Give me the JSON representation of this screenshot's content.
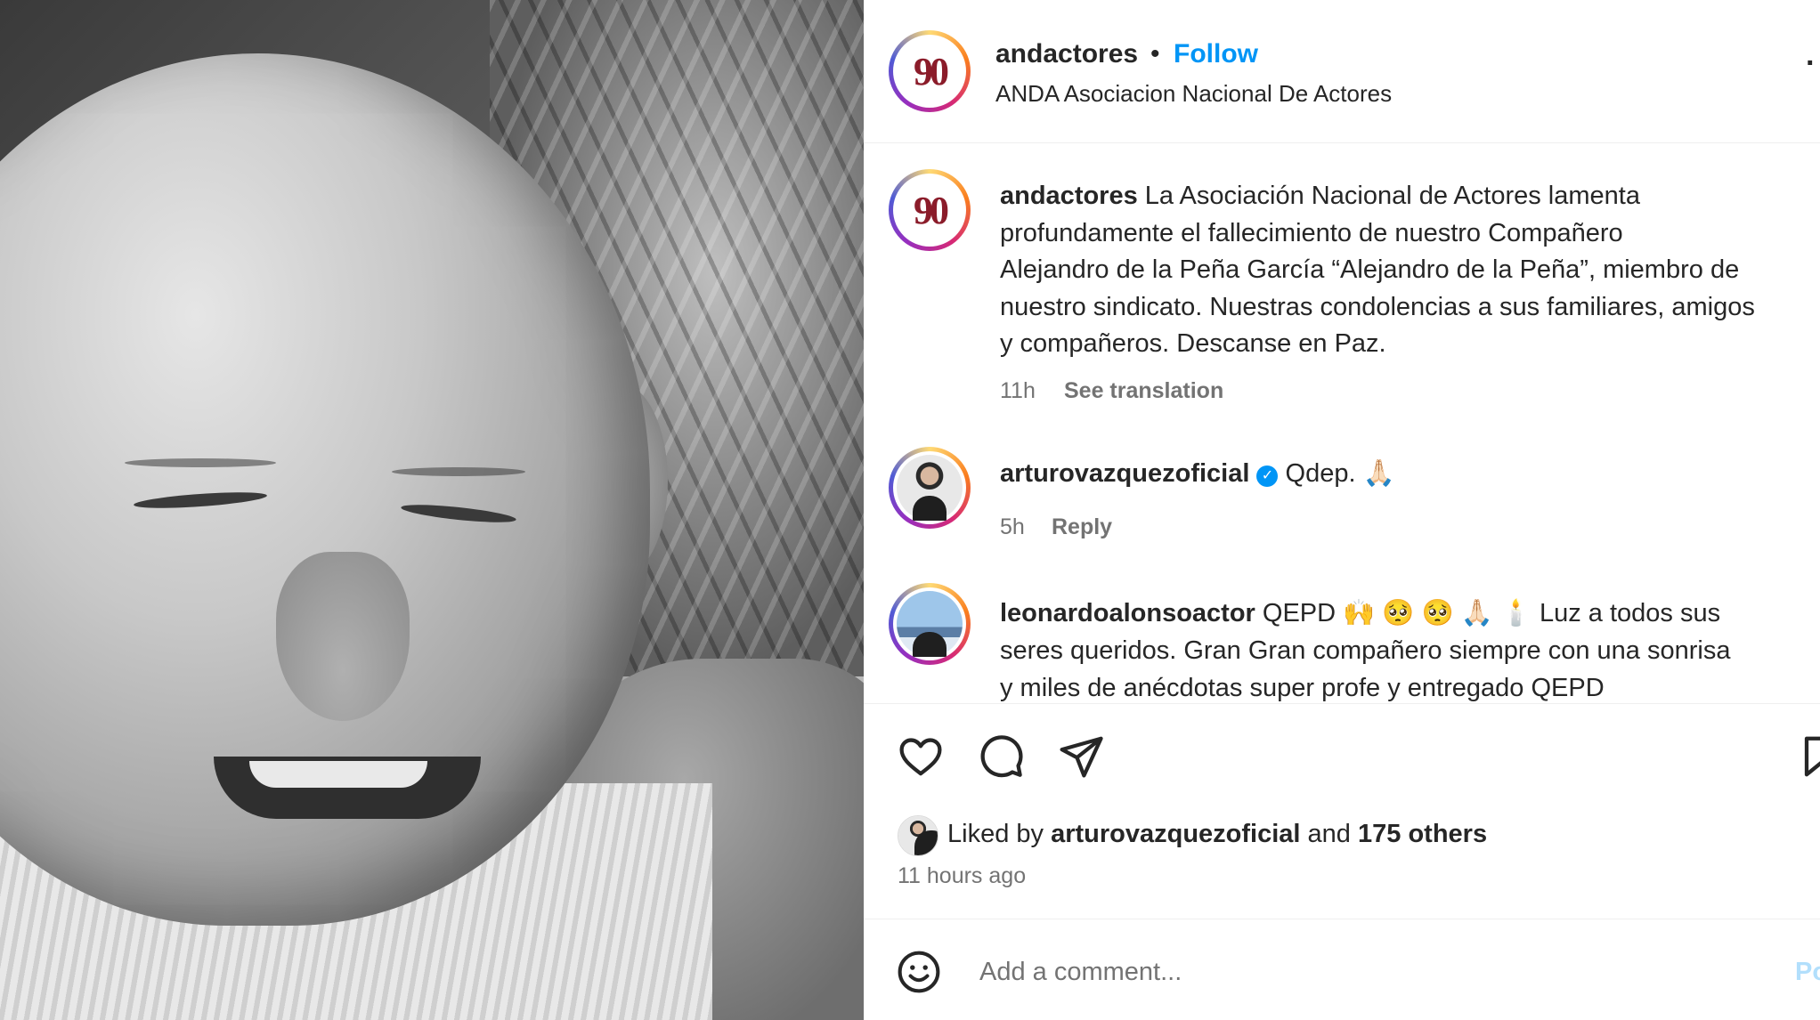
{
  "post": {
    "header": {
      "username": "andactores",
      "dot": "•",
      "follow_label": "Follow",
      "subtitle": "ANDA Asociacion Nacional De Actores",
      "avatar_logo_text": "90",
      "more_dot": "·"
    },
    "caption": {
      "username": "andactores",
      "lines": [
        "La Asociación Nacional de Actores lamenta",
        "profundamente el fallecimiento de nuestro Compañero",
        "Alejandro de la Peña García “Alejandro de la Peña”, miembro de",
        "nuestro sindicato. Nuestras condolencias a sus familiares, amigos",
        "y compañeros. Descanse en Paz."
      ],
      "time": "11h",
      "see_translation": "See translation"
    },
    "comments": [
      {
        "username": "arturovazquezoficial",
        "verified_glyph": "✓",
        "text": "Qdep. 🙏🏻",
        "time": "5h",
        "reply_label": "Reply"
      },
      {
        "username": "leonardoalonsoactor",
        "lines": [
          "QEPD 🙌 🥺 🥺 🙏🏻 🕯️  Luz a todos sus",
          "seres queridos. Gran Gran compañero siempre con una sonrisa",
          "y miles de anécdotas super profe y entregado QEPD"
        ]
      }
    ],
    "actions": {
      "like_icon": "heart-icon",
      "comment_icon": "comment-icon",
      "share_icon": "send-icon",
      "save_icon": "bookmark-icon"
    },
    "likes": {
      "prefix": "Liked by",
      "user": "arturovazquezoficial",
      "and": "and",
      "others": "175 others"
    },
    "timestamp": "11 hours ago",
    "add_comment": {
      "emoji_icon": "smiley-icon",
      "placeholder": "Add a comment...",
      "post_label": "Po"
    }
  },
  "colors": {
    "accent": "#0095f6",
    "text": "#262626",
    "secondary_text": "#737373",
    "divider": "#efefef",
    "logo": "#8b1c2a"
  }
}
